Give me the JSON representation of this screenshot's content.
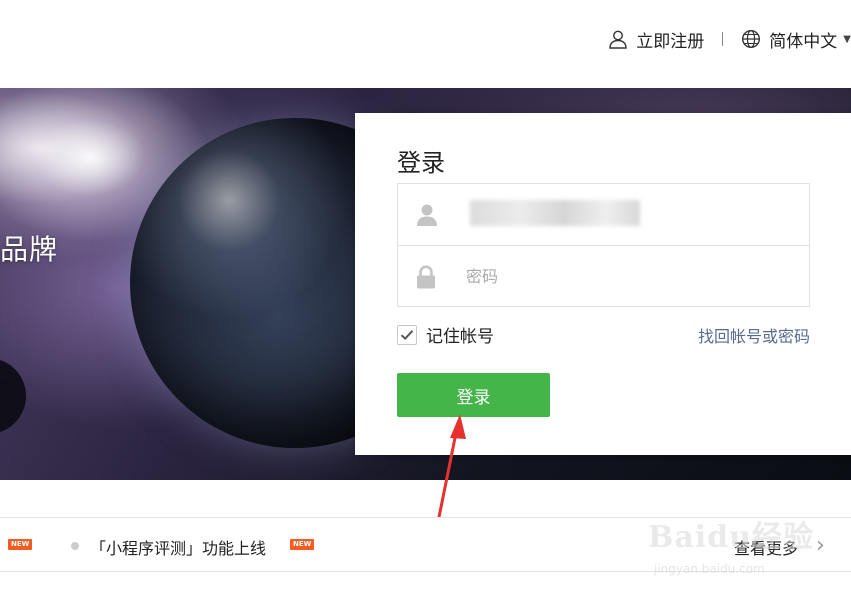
{
  "header": {
    "register_label": "立即注册",
    "language_label": "简体中文"
  },
  "banner": {
    "slogan_fragment": "品牌"
  },
  "login": {
    "title": "登录",
    "password_placeholder": "密码",
    "remember_label": "记住帐号",
    "remember_checked": true,
    "forgot_link": "找回帐号或密码",
    "submit_label": "登录",
    "accent_color": "#44b549"
  },
  "news": {
    "badge_text": "NEW",
    "item_text": "「小程序评测」功能上线",
    "more_label": "查看更多",
    "more_chevron": "›"
  },
  "watermark": {
    "brand": "Baidu经验",
    "url": "jingyan.baidu.com"
  },
  "annotation": {
    "arrow_color": "#e8312f"
  }
}
